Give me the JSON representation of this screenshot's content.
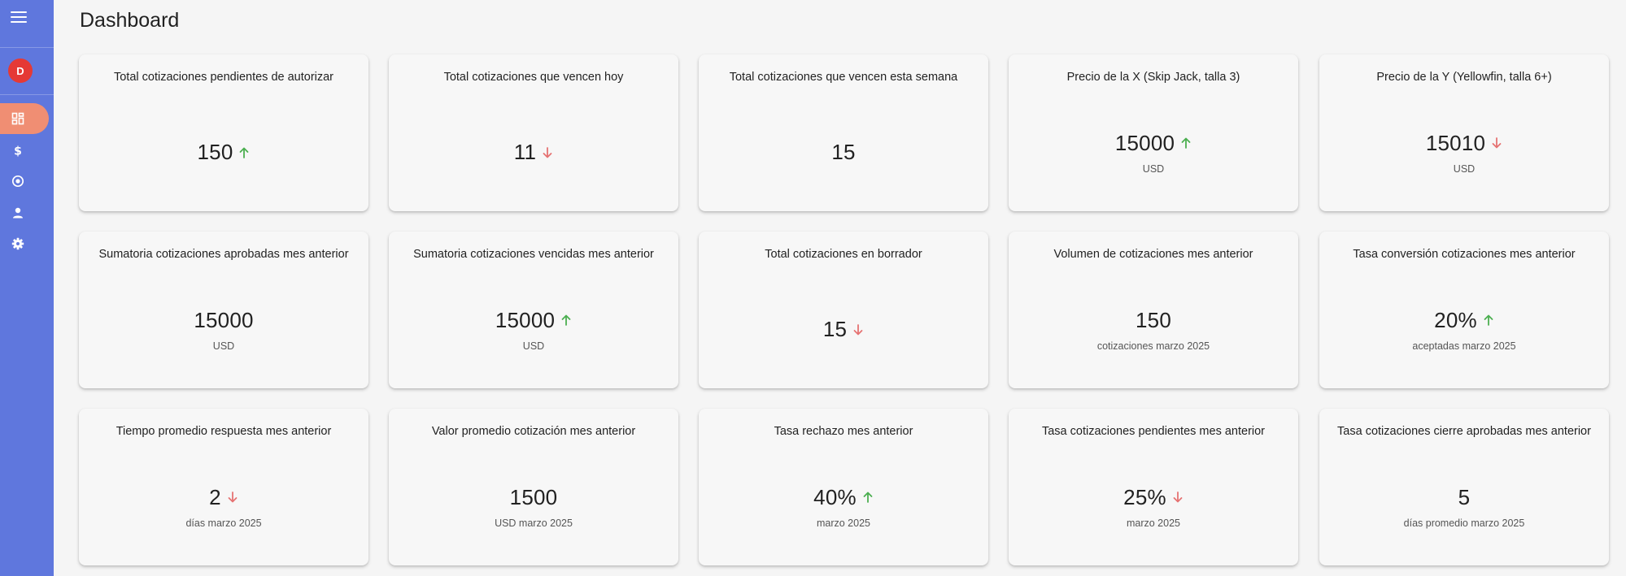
{
  "page": {
    "title": "Dashboard"
  },
  "sidebar": {
    "avatar_initial": "D",
    "items": [
      {
        "name": "dashboard",
        "active": true
      },
      {
        "name": "dollar",
        "active": false
      },
      {
        "name": "target",
        "active": false
      },
      {
        "name": "user",
        "active": false
      },
      {
        "name": "settings",
        "active": false
      }
    ]
  },
  "colors": {
    "sidebar": "#5f77dd",
    "active_item": "#f08e73",
    "avatar": "#e53935",
    "trend_up": "#4caf50",
    "trend_down": "#e57373"
  },
  "cards": [
    {
      "title": "Total cotizaciones pendientes de autorizar",
      "value": "150",
      "trend": "up",
      "sub": ""
    },
    {
      "title": "Total cotizaciones que vencen hoy",
      "value": "11",
      "trend": "down",
      "sub": ""
    },
    {
      "title": "Total cotizaciones que vencen esta semana",
      "value": "15",
      "trend": "none",
      "sub": ""
    },
    {
      "title": "Precio de la X (Skip Jack, talla 3)",
      "value": "15000",
      "trend": "up",
      "sub": "USD"
    },
    {
      "title": "Precio de la Y (Yellowfin, talla 6+)",
      "value": "15010",
      "trend": "down",
      "sub": "USD"
    },
    {
      "title": "Sumatoria cotizaciones aprobadas mes anterior",
      "value": "15000",
      "trend": "none",
      "sub": "USD"
    },
    {
      "title": "Sumatoria cotizaciones vencidas mes anterior",
      "value": "15000",
      "trend": "up",
      "sub": "USD"
    },
    {
      "title": "Total cotizaciones en borrador",
      "value": "15",
      "trend": "down",
      "sub": ""
    },
    {
      "title": "Volumen de cotizaciones mes anterior",
      "value": "150",
      "trend": "none",
      "sub": "cotizaciones marzo 2025"
    },
    {
      "title": "Tasa conversión cotizaciones mes anterior",
      "value": "20%",
      "trend": "up",
      "sub": "aceptadas marzo 2025"
    },
    {
      "title": "Tiempo promedio respuesta mes anterior",
      "value": "2",
      "trend": "down",
      "sub": "días marzo 2025"
    },
    {
      "title": "Valor promedio cotización mes anterior",
      "value": "1500",
      "trend": "none",
      "sub": "USD marzo 2025"
    },
    {
      "title": "Tasa rechazo mes anterior",
      "value": "40%",
      "trend": "up",
      "sub": "marzo 2025"
    },
    {
      "title": "Tasa cotizaciones pendientes mes anterior",
      "value": "25%",
      "trend": "down",
      "sub": "marzo 2025"
    },
    {
      "title": "Tasa cotizaciones cierre aprobadas mes anterior",
      "value": "5",
      "trend": "none",
      "sub": "días promedio marzo 2025"
    }
  ]
}
